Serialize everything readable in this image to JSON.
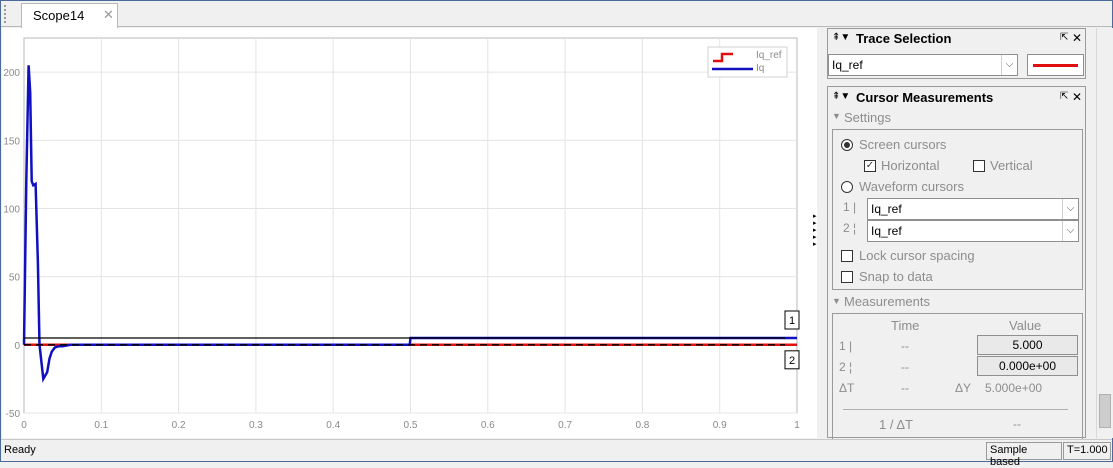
{
  "tab": {
    "title": "Scope14",
    "close": "✕"
  },
  "plot": {
    "y_ticks": [
      "200",
      "150",
      "100",
      "50",
      "0",
      "-50"
    ],
    "x_ticks": [
      "0",
      "0.1",
      "0.2",
      "0.3",
      "0.4",
      "0.5",
      "0.6",
      "0.7",
      "0.8",
      "0.9",
      "1"
    ],
    "legend": [
      "Iq_ref",
      "Iq"
    ],
    "cursor_labels": [
      "1",
      "2"
    ],
    "colors": {
      "iq_ref": "#e01010",
      "iq": "#1010c0",
      "cursor": "#000000"
    }
  },
  "chart_data": {
    "type": "line",
    "xlim": [
      0,
      1
    ],
    "ylim": [
      -50,
      225
    ],
    "grid": true,
    "legend_position": "top-right",
    "series": [
      {
        "name": "Iq_ref",
        "x": [
          0,
          0.5,
          0.5,
          1
        ],
        "y": [
          0,
          0,
          0,
          0
        ]
      },
      {
        "name": "Iq",
        "x": [
          0,
          0.003,
          0.006,
          0.008,
          0.01,
          0.012,
          0.015,
          0.018,
          0.02,
          0.025,
          0.03,
          0.033,
          0.036,
          0.04,
          0.045,
          0.05,
          0.06,
          0.1,
          0.2,
          0.3,
          0.4,
          0.499,
          0.5,
          0.6,
          0.7,
          0.8,
          0.9,
          1
        ],
        "y": [
          0,
          120,
          205,
          185,
          120,
          117,
          118,
          60,
          0,
          -25,
          -20,
          -10,
          -5,
          -2,
          -1,
          -1,
          0,
          0,
          0,
          0,
          0,
          0,
          5,
          5,
          5,
          5,
          5,
          5
        ]
      }
    ],
    "cursors": [
      {
        "label": "1",
        "y": 5
      },
      {
        "label": "2",
        "y": 0
      }
    ]
  },
  "trace_selection": {
    "title": "Trace Selection",
    "selected": "Iq_ref",
    "line_color": "#e01010"
  },
  "cursor_measurements": {
    "title": "Cursor Measurements",
    "settings_label": "Settings",
    "screen_cursors": "Screen cursors",
    "horizontal": "Horizontal",
    "vertical": "Vertical",
    "waveform_cursors": "Waveform cursors",
    "cursor1_label": "1 |",
    "cursor2_label": "2 ¦",
    "cursor1_trace": "Iq_ref",
    "cursor2_trace": "Iq_ref",
    "lock_spacing": "Lock cursor spacing",
    "snap_to_data": "Snap to data",
    "measurements_label": "Measurements",
    "col_time": "Time",
    "col_value": "Value",
    "row1_label": "1 |",
    "row1_time": "--",
    "row1_value": "5.000",
    "row2_label": "2 ¦",
    "row2_time": "--",
    "row2_value": "0.000e+00",
    "dt_label": "ΔT",
    "dt_value": "--",
    "dy_label": "ΔY",
    "dy_value": "5.000e+00",
    "inv_dt_label": "1 / ΔT",
    "inv_dt_value": "--"
  },
  "status": {
    "ready": "Ready",
    "mode": "Sample based",
    "time": "T=1.000"
  }
}
